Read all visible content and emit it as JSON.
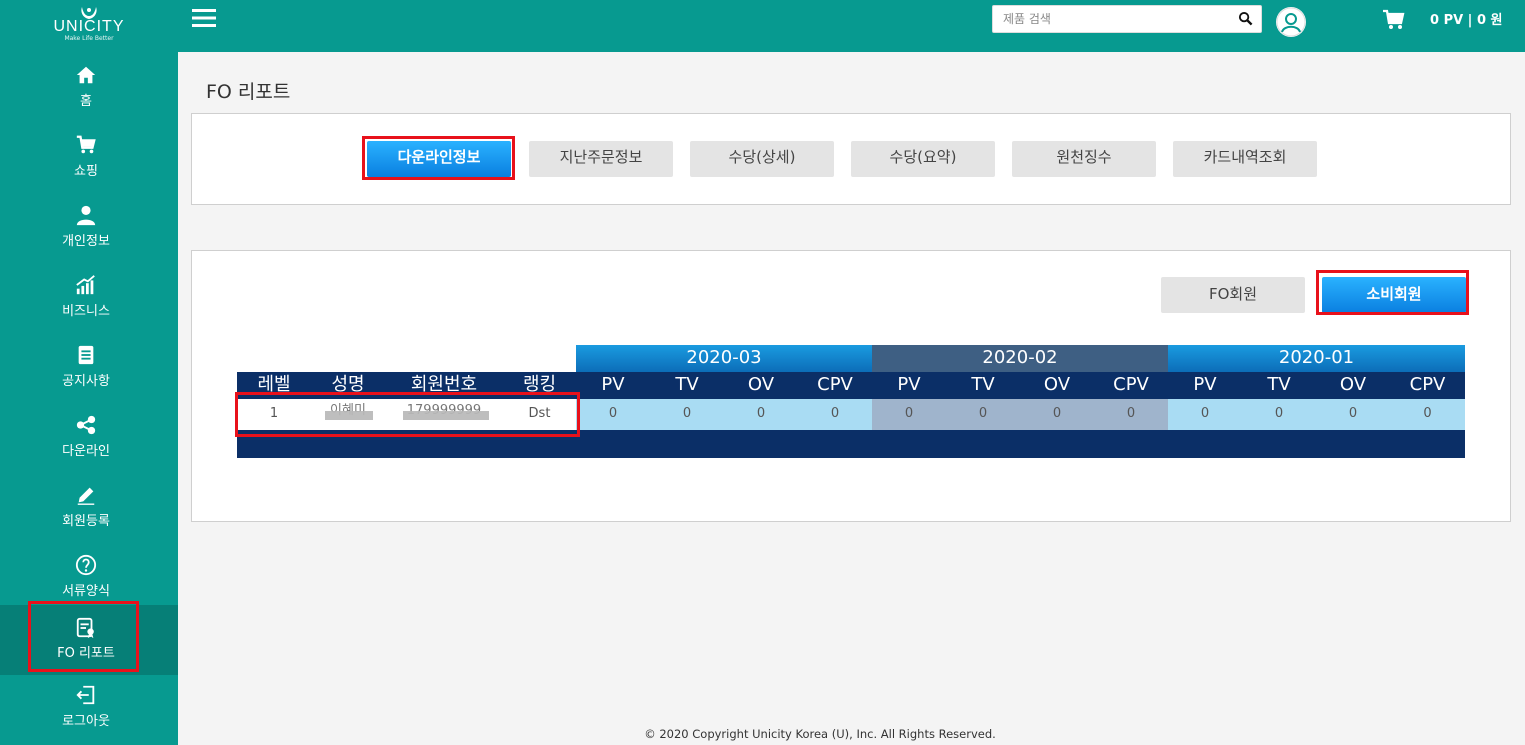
{
  "brand": {
    "name": "UNICITY",
    "tagline": "Make Life Better"
  },
  "sidebar": {
    "items": [
      {
        "label": "홈",
        "icon": "home-icon"
      },
      {
        "label": "쇼핑",
        "icon": "cart-icon"
      },
      {
        "label": "개인정보",
        "icon": "person-icon"
      },
      {
        "label": "비즈니스",
        "icon": "growth-chart-icon"
      },
      {
        "label": "공지사항",
        "icon": "document-icon"
      },
      {
        "label": "다운라인",
        "icon": "share-nodes-icon"
      },
      {
        "label": "회원등록",
        "icon": "pencil-icon"
      },
      {
        "label": "서류양식",
        "icon": "question-circle-icon"
      },
      {
        "label": "FO 리포트",
        "icon": "report-icon",
        "active": true
      },
      {
        "label": "로그아웃",
        "icon": "logout-icon"
      }
    ]
  },
  "topbar": {
    "search_placeholder": "제품 검색",
    "cart_summary": "0 PV  |  0 원"
  },
  "page": {
    "title": "FO 리포트"
  },
  "report_tabs": [
    {
      "label": "다운라인정보",
      "active": true
    },
    {
      "label": "지난주문정보"
    },
    {
      "label": "수당(상세)"
    },
    {
      "label": "수당(요약)"
    },
    {
      "label": "원천징수"
    },
    {
      "label": "카드내역조회"
    }
  ],
  "member_type_buttons": [
    {
      "label": "FO회원"
    },
    {
      "label": "소비회원",
      "active": true
    }
  ],
  "table": {
    "fixed_headers": [
      "레벨",
      "성명",
      "회원번호",
      "랭킹"
    ],
    "months": [
      "2020-03",
      "2020-02",
      "2020-01"
    ],
    "metric_headers": [
      "PV",
      "TV",
      "OV",
      "CPV"
    ],
    "rows": [
      {
        "level": "1",
        "name": "이혜미",
        "member_no": "179999999",
        "rank": "Dst",
        "values": [
          "0",
          "0",
          "0",
          "0",
          "0",
          "0",
          "0",
          "0",
          "0",
          "0",
          "0",
          "0"
        ]
      }
    ]
  },
  "footer": {
    "copyright": "© 2020 Copyright Unicity Korea (U), Inc. All Rights Reserved."
  },
  "colors": {
    "teal": "#079a90",
    "navy": "#0b2f67",
    "blue": "#0a7fe0",
    "highlight_red": "#e8111b"
  }
}
